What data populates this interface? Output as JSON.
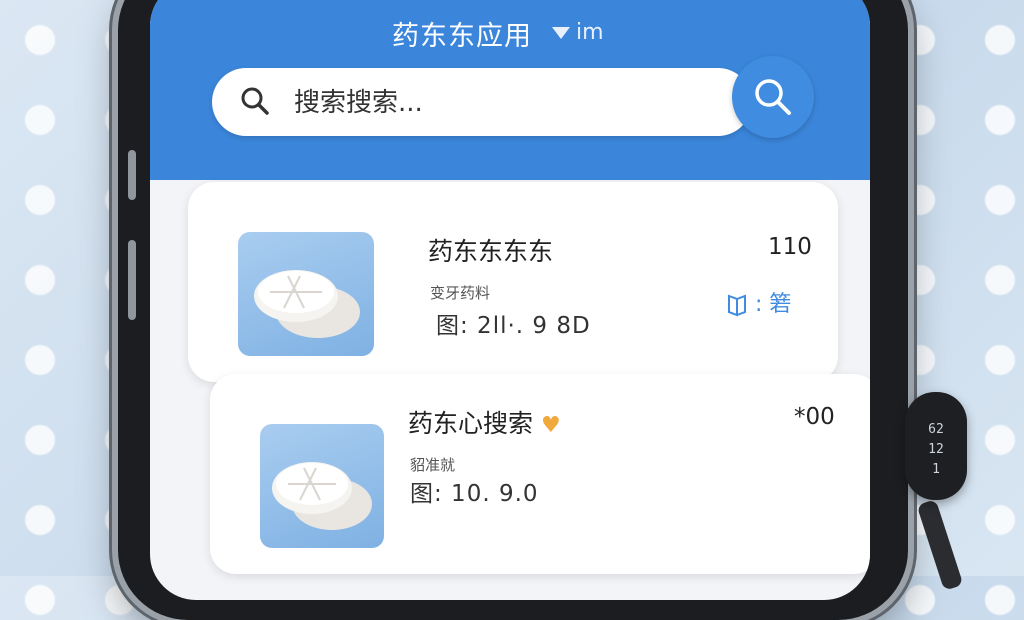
{
  "header": {
    "title": "药东东应用",
    "status_text": "im"
  },
  "search": {
    "placeholder": "搜索搜索..."
  },
  "products": [
    {
      "name": "药东东东东",
      "subtitle": "变牙药料",
      "spec": "图: 2ll·. 9 8D",
      "price": "110",
      "action_label": ": 箬"
    },
    {
      "name": "药东心搜索",
      "subtitle": "貂准就",
      "spec": "图: 10. 9.0",
      "price": "*00",
      "favorite": true
    }
  ],
  "wearable": {
    "line1": "62",
    "line2": "12",
    "line3": "1"
  },
  "colors": {
    "header": "#3b86db",
    "accent": "#3f8ce0",
    "heart": "#f0a93a"
  },
  "icons": {
    "search": "search-icon",
    "book": "book-icon",
    "heart": "heart-icon"
  }
}
